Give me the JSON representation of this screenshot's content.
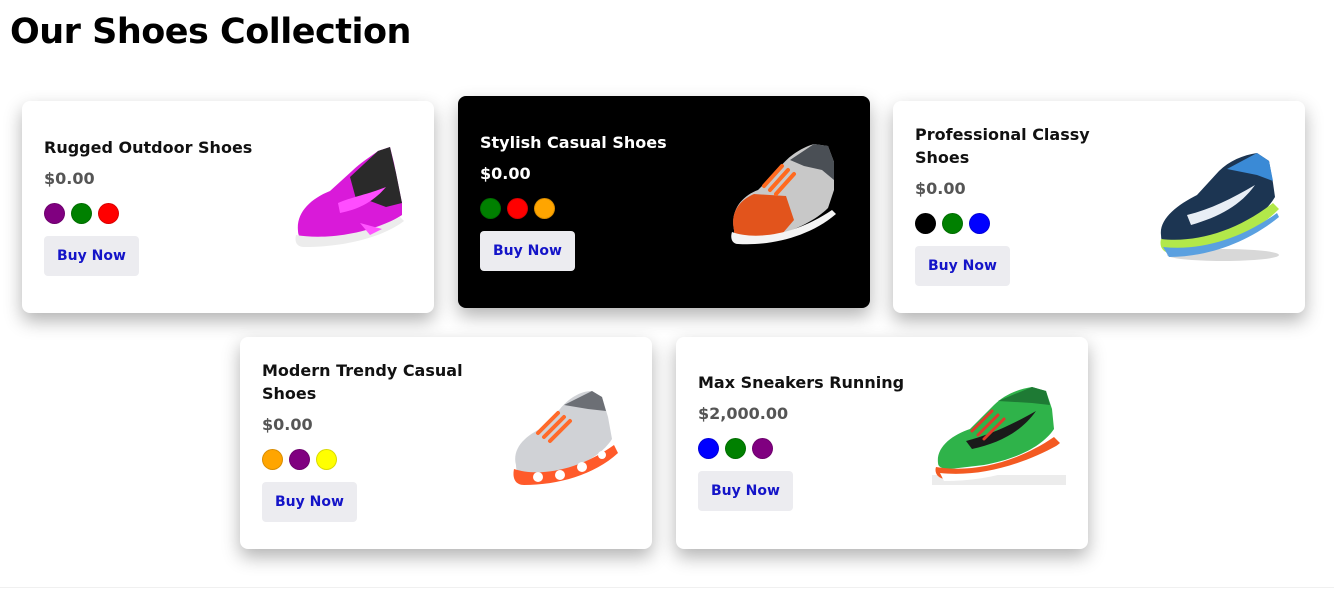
{
  "page": {
    "title": "Our Shoes Collection"
  },
  "products": [
    {
      "name": "Rugged Outdoor Shoes",
      "price": "$0.00",
      "colors": [
        "#800080",
        "#008000",
        "#ff0000"
      ],
      "buy_label": "Buy Now",
      "icon": "pink-sneaker-image"
    },
    {
      "name": "Stylish Casual Shoes",
      "price": "$0.00",
      "colors": [
        "#008000",
        "#ff0000",
        "#ffa500"
      ],
      "buy_label": "Buy Now",
      "icon": "orange-grey-sneaker-image",
      "highlighted": true
    },
    {
      "name": "Professional Classy Shoes",
      "price": "$0.00",
      "colors": [
        "#000000",
        "#008000",
        "#0000ff"
      ],
      "buy_label": "Buy Now",
      "icon": "navy-sneaker-image"
    },
    {
      "name": "Modern Trendy Casual Shoes",
      "price": "$0.00",
      "colors": [
        "#ffa500",
        "#800080",
        "#ffff00"
      ],
      "buy_label": "Buy Now",
      "icon": "orange-silver-sneaker-image"
    },
    {
      "name": "Max Sneakers Running",
      "price": "$2,000.00",
      "colors": [
        "#0000ff",
        "#008000",
        "#800080"
      ],
      "buy_label": "Buy Now",
      "icon": "green-sneaker-image"
    }
  ]
}
